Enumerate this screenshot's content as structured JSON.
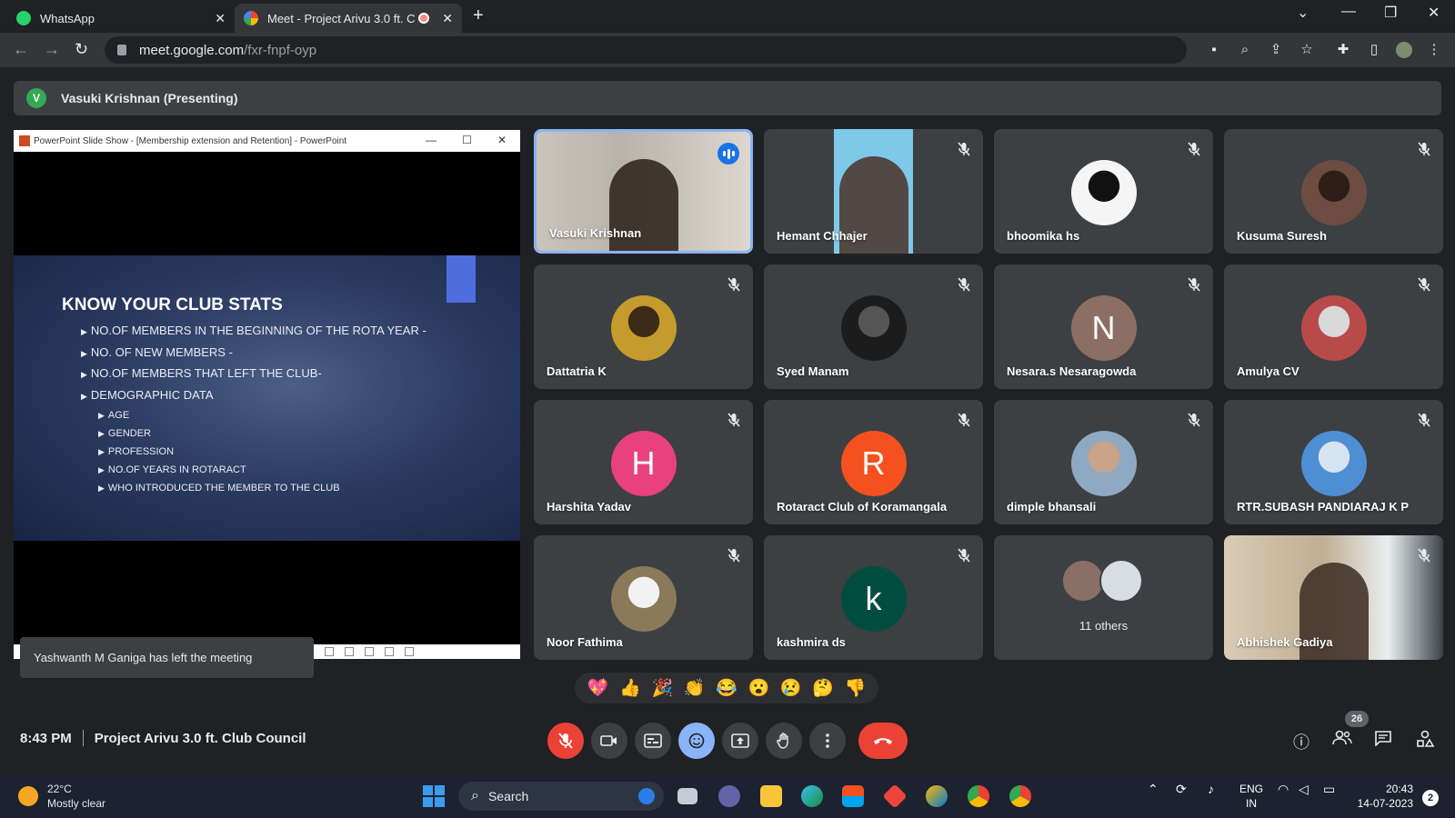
{
  "browser": {
    "tabs": [
      {
        "title": "WhatsApp",
        "close": "✕"
      },
      {
        "title": "Meet - Project Arivu 3.0 ft. C",
        "close": "✕"
      }
    ],
    "new_tab": "+",
    "url_host": "meet.google.com",
    "url_path": "/fxr-fnpf-oyp"
  },
  "presenting": {
    "avatar_letter": "V",
    "label": "Vasuki Krishnan (Presenting)"
  },
  "screen_share": {
    "window_title": "PowerPoint Slide Show - [Membership extension and Retention] - PowerPoint",
    "slide": {
      "title": "KNOW YOUR CLUB STATS",
      "bullets": [
        "NO.OF MEMBERS IN THE BEGINNING OF THE ROTA YEAR -",
        "NO. OF NEW MEMBERS -",
        "NO.OF MEMBERS THAT LEFT THE CLUB-",
        "DEMOGRAPHIC DATA"
      ],
      "sub_bullets": [
        "AGE",
        "GENDER",
        "PROFESSION",
        "NO.OF YEARS IN ROTARACT",
        "WHO INTRODUCED THE MEMBER TO THE CLUB"
      ]
    }
  },
  "toast": "Yashwanth M Ganiga has left the meeting",
  "participants": [
    {
      "name": "Vasuki Krishnan"
    },
    {
      "name": "Hemant Chhajer"
    },
    {
      "name": "bhoomika hs"
    },
    {
      "name": "Kusuma Suresh"
    },
    {
      "name": "Dattatria K"
    },
    {
      "name": "Syed Manam"
    },
    {
      "name": "Nesara.s Nesaragowda",
      "letter": "N",
      "color": "#8d6e63"
    },
    {
      "name": "Amulya CV"
    },
    {
      "name": "Harshita Yadav",
      "letter": "H",
      "color": "#e8417d"
    },
    {
      "name": "Rotaract Club of Koramangala",
      "letter": "R",
      "color": "#f4511e"
    },
    {
      "name": "dimple bhansali"
    },
    {
      "name": "RTR.SUBASH PANDIARAJ K P"
    },
    {
      "name": "Noor Fathima"
    },
    {
      "name": "kashmira ds",
      "letter": "k",
      "color": "#004d40"
    },
    {
      "name": "11 others"
    },
    {
      "name": "Abhishek Gadiya"
    }
  ],
  "reactions": [
    "💖",
    "👍",
    "🎉",
    "👏",
    "😂",
    "😮",
    "😢",
    "🤔",
    "👎"
  ],
  "meeting": {
    "time": "8:43 PM",
    "title": "Project Arivu 3.0 ft. Club Council",
    "people_count": "26"
  },
  "taskbar": {
    "temperature": "22°C",
    "weather": "Mostly clear",
    "search": "Search",
    "lang": "ENG",
    "region": "IN",
    "clock_time": "20:43",
    "clock_date": "14-07-2023",
    "notifications": "2"
  },
  "colors": {
    "accent_blue": "#8ab4f8",
    "hangup_red": "#ea4335",
    "tile_bg": "#3c4043"
  }
}
